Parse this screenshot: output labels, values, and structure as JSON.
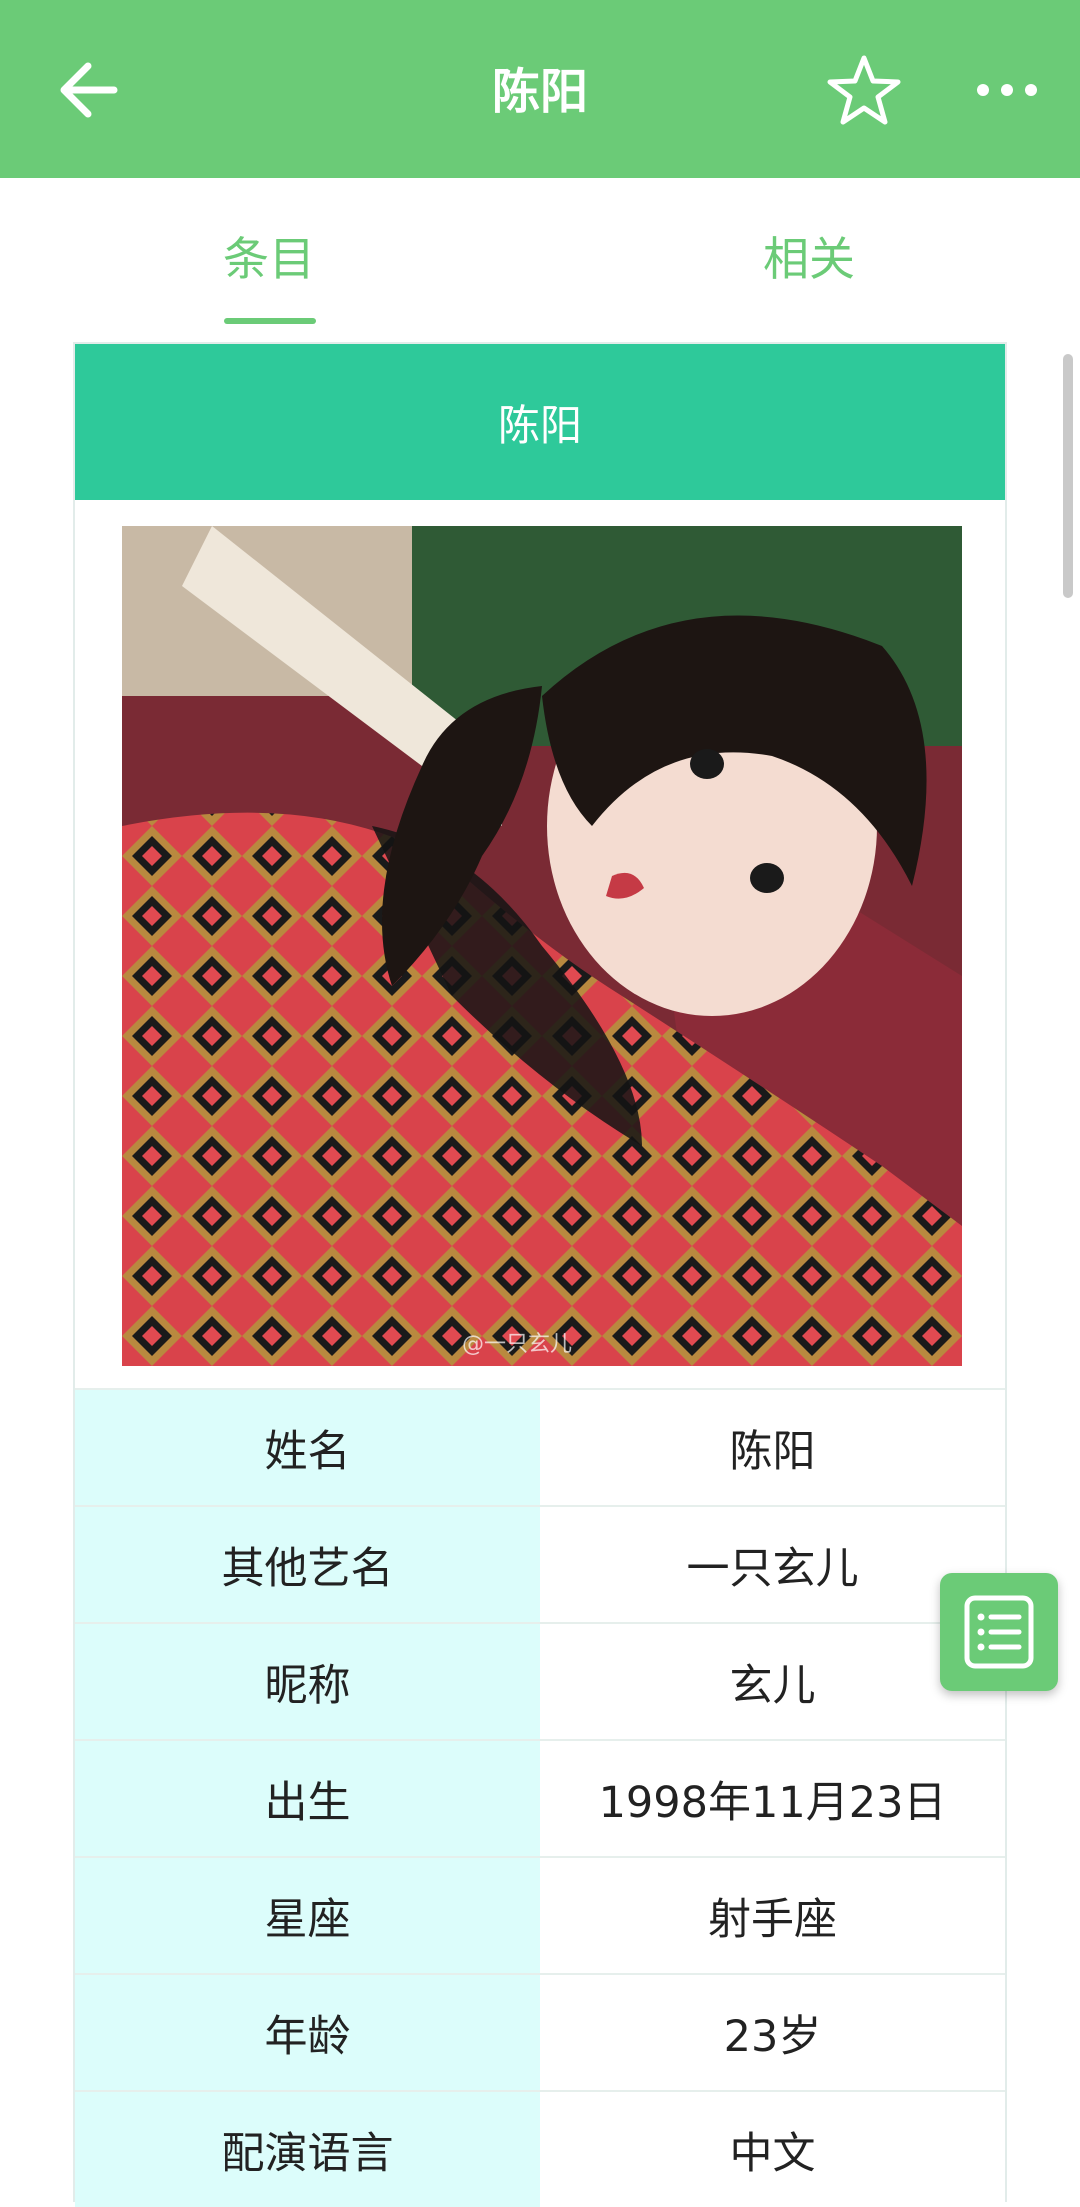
{
  "appbar": {
    "title": "陈阳",
    "background_color": "#6bcb77",
    "icons": [
      "back-arrow-icon",
      "star-icon",
      "more-icon"
    ]
  },
  "tabs": [
    {
      "label": "条目",
      "selected": true
    },
    {
      "label": "相关",
      "selected": false
    }
  ],
  "card": {
    "header_title": "陈阳",
    "header_color": "#2ec99a",
    "rows": [
      {
        "key": "姓名",
        "value": "陈阳"
      },
      {
        "key": "其他艺名",
        "value": "一只玄儿"
      },
      {
        "key": "昵称",
        "value": "玄儿"
      },
      {
        "key": "出生",
        "value": "1998年11月23日"
      },
      {
        "key": "星座",
        "value": "射手座"
      },
      {
        "key": "年龄",
        "value": "23岁"
      },
      {
        "key": "配演语言",
        "value": "中文"
      }
    ]
  },
  "fab": {
    "icon": "list-icon"
  }
}
